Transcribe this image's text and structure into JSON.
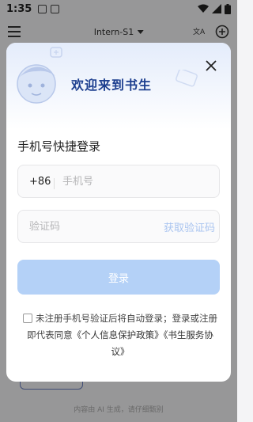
{
  "status_bar": {
    "time": "1:35"
  },
  "top_bar": {
    "model_name": "Intern-S1"
  },
  "background": {
    "footer_note": "内容由 AI 生成，请仔细甄别"
  },
  "modal": {
    "title": "欢迎来到书生",
    "section_title": "手机号快捷登录",
    "phone": {
      "prefix": "+86",
      "placeholder": "手机号",
      "value": ""
    },
    "code": {
      "placeholder": "验证码",
      "value": "",
      "get_code_label": "获取验证码"
    },
    "login_label": "登录",
    "agreement": {
      "text": "未注册手机号验证后将自动登录；登录或注册即代表同意",
      "privacy_link": "《个人信息保护政策》",
      "service_link": "《书生服务协议》"
    }
  },
  "colors": {
    "title": "#1d3f8f",
    "login_button": "#b4d1f7",
    "get_code": "#a9c4f0"
  }
}
